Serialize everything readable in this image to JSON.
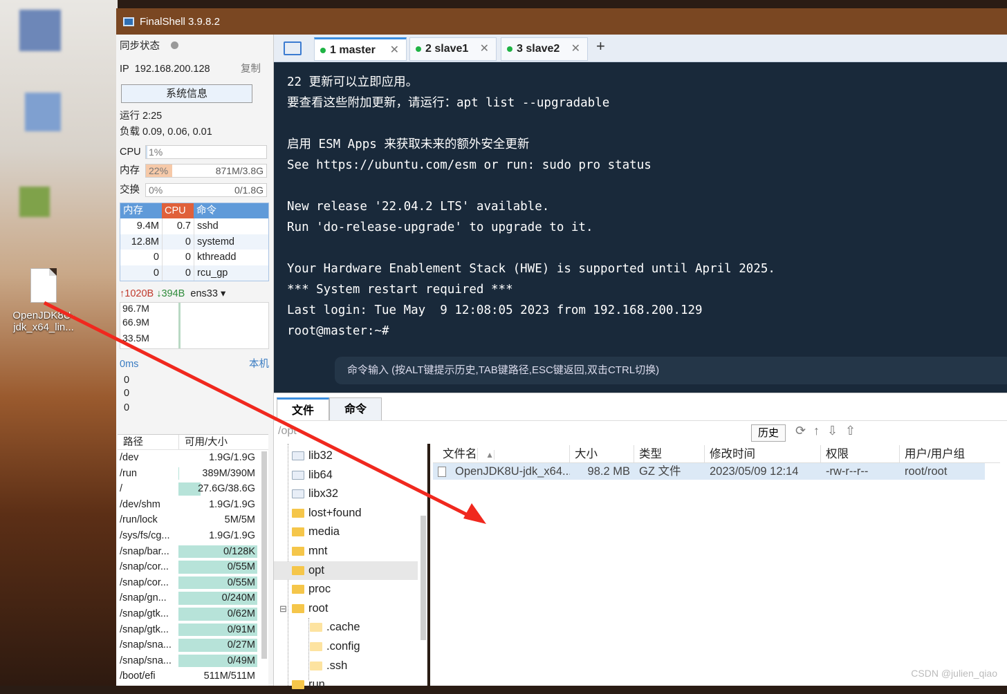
{
  "app": {
    "title": "FinalShell 3.9.8.2"
  },
  "desktop": {
    "file_label": "OpenJDK8U-jdk_x64_lin..."
  },
  "left": {
    "sync_label": "同步状态",
    "ip_label": "IP",
    "ip": "192.168.200.128",
    "copy": "复制",
    "sysinfo": "系统信息",
    "uptime": "运行 2:25",
    "load": "负载 0.09, 0.06, 0.01",
    "cpu_label": "CPU",
    "cpu_pct": "1%",
    "cpu_level": 0.01,
    "mem_label": "内存",
    "mem_pct": "22%",
    "mem_value": "871M/3.8G",
    "mem_level": 0.22,
    "swap_label": "交换",
    "swap_pct": "0%",
    "swap_value": "0/1.8G",
    "proc_headers": [
      "内存",
      "CPU",
      "命令"
    ],
    "procs": [
      {
        "mem": "9.4M",
        "cpu": "0.7",
        "cmd": "sshd"
      },
      {
        "mem": "12.8M",
        "cpu": "0",
        "cmd": "systemd"
      },
      {
        "mem": "0",
        "cpu": "0",
        "cmd": "kthreadd"
      },
      {
        "mem": "0",
        "cpu": "0",
        "cmd": "rcu_gp"
      }
    ],
    "net_up": "1020B",
    "net_down": "394B",
    "iface": "ens33",
    "net_ticks": [
      "96.7M",
      "66.9M",
      "33.5M"
    ],
    "ping_label": "0ms",
    "ping_host": "本机",
    "ping_vals": [
      "0",
      "0",
      "0"
    ],
    "disk_headers": [
      "路径",
      "可用/大小"
    ],
    "disks": [
      {
        "path": "/dev",
        "size": "1.9G/1.9G",
        "used": 0
      },
      {
        "path": "/run",
        "size": "389M/390M",
        "used": 0.01
      },
      {
        "path": "/",
        "size": "27.6G/38.6G",
        "used": 0.28
      },
      {
        "path": "/dev/shm",
        "size": "1.9G/1.9G",
        "used": 0
      },
      {
        "path": "/run/lock",
        "size": "5M/5M",
        "used": 0
      },
      {
        "path": "/sys/fs/cg...",
        "size": "1.9G/1.9G",
        "used": 0
      },
      {
        "path": "/snap/bar...",
        "size": "0/128K",
        "used": 1
      },
      {
        "path": "/snap/cor...",
        "size": "0/55M",
        "used": 1
      },
      {
        "path": "/snap/cor...",
        "size": "0/55M",
        "used": 1
      },
      {
        "path": "/snap/gn...",
        "size": "0/240M",
        "used": 1
      },
      {
        "path": "/snap/gtk...",
        "size": "0/62M",
        "used": 1
      },
      {
        "path": "/snap/gtk...",
        "size": "0/91M",
        "used": 1
      },
      {
        "path": "/snap/sna...",
        "size": "0/27M",
        "used": 1
      },
      {
        "path": "/snap/sna...",
        "size": "0/49M",
        "used": 1
      },
      {
        "path": "/boot/efi",
        "size": "511M/511M",
        "used": 0
      }
    ]
  },
  "tabs": [
    {
      "label": "1  master"
    },
    {
      "label": "2  slave1"
    },
    {
      "label": "3  slave2"
    }
  ],
  "terminal": {
    "lines": [
      "22 更新可以立即应用。",
      "要查看这些附加更新，请运行：apt list --upgradable",
      "",
      "启用 ESM Apps 来获取未来的额外安全更新",
      "See https://ubuntu.com/esm or run: sudo pro status",
      "",
      "New release '22.04.2 LTS' available.",
      "Run 'do-release-upgrade' to upgrade to it.",
      "",
      "Your Hardware Enablement Stack (HWE) is supported until April 2025.",
      "*** System restart required ***",
      "Last login: Tue May  9 12:08:05 2023 from 192.168.200.129",
      "root@master:~#"
    ],
    "cmd_placeholder": "命令输入 (按ALT键提示历史,TAB键路径,ESC键返回,双击CTRL切换)"
  },
  "files": {
    "tabs": [
      "文件",
      "命令"
    ],
    "path": "/opt",
    "history": "历史",
    "tree": [
      "lib32",
      "lib64",
      "libx32",
      "lost+found",
      "media",
      "mnt",
      "opt",
      "proc",
      "root",
      ".cache",
      ".config",
      ".ssh",
      "run"
    ],
    "headers": [
      "文件名",
      "大小",
      "类型",
      "修改时间",
      "权限",
      "用户/用户组"
    ],
    "rows": [
      {
        "name": "OpenJDK8U-jdk_x64...",
        "size": "98.2 MB",
        "type": "GZ 文件",
        "mtime": "2023/05/09 12:14",
        "perm": "-rw-r--r--",
        "owner": "root/root"
      }
    ]
  },
  "watermark": "CSDN @julien_qiao"
}
